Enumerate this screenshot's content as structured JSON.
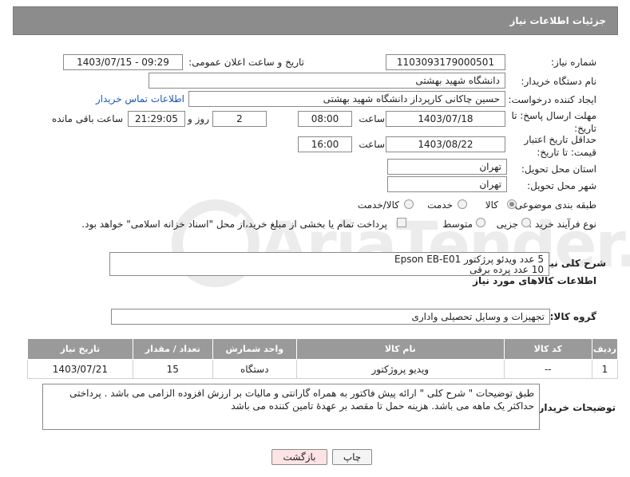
{
  "header": {
    "title": "جزئیات اطلاعات نیاز"
  },
  "need_number": {
    "label": "شماره نیاز:",
    "value": "1103093179000501"
  },
  "announce": {
    "label": "تاریخ و ساعت اعلان عمومی:",
    "value": "1403/07/15 - 09:29"
  },
  "buyer_org": {
    "label": "نام دستگاه خریدار:",
    "value": "دانشگاه شهید بهشتی"
  },
  "requester": {
    "label": "ایجاد کننده درخواست:",
    "value": "حسین چاکانی کارپرداز دانشگاه شهید بهشتی",
    "contact_link": "اطلاعات تماس خریدار"
  },
  "deadline": {
    "label": "مهلت ارسال پاسخ: تا تاریخ:",
    "date": "1403/07/18",
    "time_label": "ساعت",
    "time": "08:00",
    "days": "2",
    "days_label": "روز و",
    "remaining": "21:29:05",
    "remaining_label": "ساعت باقی مانده"
  },
  "min_validity": {
    "label": "حداقل تاریخ اعتبار قیمت: تا تاریخ:",
    "date": "1403/08/22",
    "time_label": "ساعت",
    "time": "16:00"
  },
  "province": {
    "label": "استان محل تحویل:",
    "value": "تهران"
  },
  "city": {
    "label": "شهر محل تحویل:",
    "value": "تهران"
  },
  "category": {
    "label": "طبقه بندی موضوعی:",
    "options": [
      "کالا",
      "خدمت",
      "کالا/خدمت"
    ],
    "selected": "کالا"
  },
  "purchase_type": {
    "label": "نوع فرآیند خرید :",
    "options": [
      "جزیی",
      "متوسط"
    ],
    "checkbox_text": "پرداخت تمام یا بخشی از مبلغ خرید،از محل \"اسناد خزانه اسلامی\" خواهد بود."
  },
  "general_desc": {
    "label": "شرح کلی نیاز:",
    "line1": "5 عدد ویدئو پرژکتور Epson EB-E01",
    "line2": "10 عدد پرده برقی"
  },
  "goods_info": {
    "title": "اطلاعات کالاهای مورد نیاز"
  },
  "goods_group": {
    "label": "گروه کالا:",
    "value": "تجهیزات و وسایل تحصیلی واداری"
  },
  "table": {
    "headers": [
      "ردیف",
      "کد کالا",
      "نام کالا",
      "واحد شمارش",
      "تعداد / مقدار",
      "تاریخ نیاز"
    ],
    "rows": [
      {
        "idx": "1",
        "code": "--",
        "name": "ویدیو پروژکتور",
        "unit": "دستگاه",
        "qty": "15",
        "date": "1403/07/21"
      }
    ]
  },
  "buyer_notes": {
    "label": "توضیحات خریدار:",
    "text": "طبق توضیحات \" شرح کلی \"  ارائه پیش فاکتور به همراه گارانتی و مالیات بر ارزش افزوده الزامی می باشد . پرداختی حداکثر یک ماهه می باشد. هزینه حمل تا مقصد بر عهدهٔ تامین کننده می باشد"
  },
  "buttons": {
    "print": "چاپ",
    "back": "بازگشت"
  },
  "watermark": {
    "text": "AriaTender.neT"
  }
}
